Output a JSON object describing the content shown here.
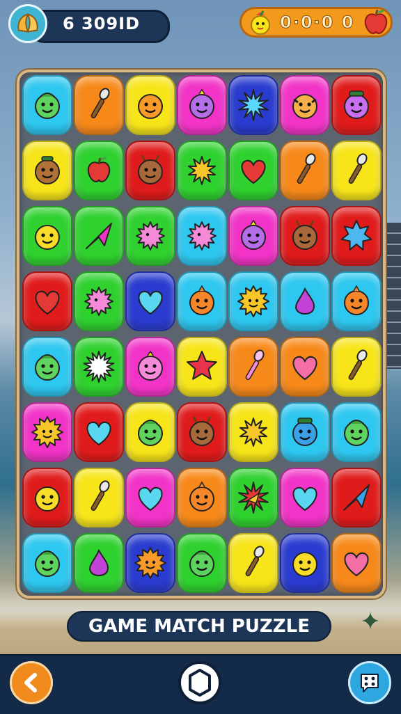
{
  "header": {
    "currency": {
      "icon": "golden-wings-icon",
      "amount": "6 309ID"
    },
    "lives": {
      "left_icon": "chick-fruit-icon",
      "value": "0·0·0 0",
      "right_icon": "apple-icon"
    }
  },
  "board": {
    "columns": 7,
    "rows": [
      [
        {
          "color": "#2ec7f0",
          "icon": "green-blob-face"
        },
        {
          "color": "#f7891a",
          "icon": "microphone"
        },
        {
          "color": "#f7e51a",
          "icon": "orange-smiley-face"
        },
        {
          "color": "#f233c7",
          "icon": "purple-bird-face"
        },
        {
          "color": "#2a3ccf",
          "icon": "blue-starburst"
        },
        {
          "color": "#f233c7",
          "icon": "orange-cow-face"
        },
        {
          "color": "#e01b1b",
          "icon": "purple-capped-face"
        }
      ],
      [
        {
          "color": "#f7e51a",
          "icon": "brown-monkey-face"
        },
        {
          "color": "#2fd12f",
          "icon": "red-apple"
        },
        {
          "color": "#e01b1b",
          "icon": "brown-deer-face"
        },
        {
          "color": "#2fd12f",
          "icon": "yellow-star"
        },
        {
          "color": "#2fd12f",
          "icon": "red-heart"
        },
        {
          "color": "#f7891a",
          "icon": "microphone"
        },
        {
          "color": "#f7e51a",
          "icon": "microphone"
        }
      ],
      [
        {
          "color": "#2fd12f",
          "icon": "yellow-smiley-face"
        },
        {
          "color": "#2fd12f",
          "icon": "pink-arrow"
        },
        {
          "color": "#2fd12f",
          "icon": "pink-spiky-ball"
        },
        {
          "color": "#2ec7f0",
          "icon": "pink-spiky-ball"
        },
        {
          "color": "#f233c7",
          "icon": "purple-bird-face"
        },
        {
          "color": "#e01b1b",
          "icon": "brown-deer-face"
        },
        {
          "color": "#e01b1b",
          "icon": "blue-splat"
        }
      ],
      [
        {
          "color": "#e01b1b",
          "icon": "red-heart"
        },
        {
          "color": "#2fd12f",
          "icon": "pink-spiky-ball"
        },
        {
          "color": "#2a3ccf",
          "icon": "cyan-heart"
        },
        {
          "color": "#2ec7f0",
          "icon": "orange-fish-face"
        },
        {
          "color": "#2ec7f0",
          "icon": "yellow-sun-face"
        },
        {
          "color": "#2ec7f0",
          "icon": "purple-drop"
        },
        {
          "color": "#2ec7f0",
          "icon": "orange-fish-face"
        }
      ],
      [
        {
          "color": "#2ec7f0",
          "icon": "green-blob-face"
        },
        {
          "color": "#2fd12f",
          "icon": "white-starburst"
        },
        {
          "color": "#f233c7",
          "icon": "pink-bird-face"
        },
        {
          "color": "#f7e51a",
          "icon": "red-star"
        },
        {
          "color": "#f7891a",
          "icon": "pink-microphone"
        },
        {
          "color": "#f7891a",
          "icon": "pink-heart"
        },
        {
          "color": "#f7e51a",
          "icon": "microphone"
        }
      ],
      [
        {
          "color": "#f233c7",
          "icon": "yellow-sun-face"
        },
        {
          "color": "#e01b1b",
          "icon": "cyan-heart"
        },
        {
          "color": "#f7e51a",
          "icon": "green-blob-face"
        },
        {
          "color": "#e01b1b",
          "icon": "brown-deer-face"
        },
        {
          "color": "#f7e51a",
          "icon": "yellow-star"
        },
        {
          "color": "#2ec7f0",
          "icon": "blue-capped-face"
        },
        {
          "color": "#2ec7f0",
          "icon": "green-blob-face"
        }
      ],
      [
        {
          "color": "#e01b1b",
          "icon": "yellow-smiley-face"
        },
        {
          "color": "#f7e51a",
          "icon": "microphone"
        },
        {
          "color": "#f233c7",
          "icon": "cyan-heart"
        },
        {
          "color": "#f7891a",
          "icon": "orange-fish-face"
        },
        {
          "color": "#2fd12f",
          "icon": "red-starburst"
        },
        {
          "color": "#f233c7",
          "icon": "cyan-heart"
        },
        {
          "color": "#e01b1b",
          "icon": "blue-arrow"
        }
      ],
      [
        {
          "color": "#2ec7f0",
          "icon": "green-blob-face"
        },
        {
          "color": "#2fd12f",
          "icon": "purple-drop"
        },
        {
          "color": "#2a3ccf",
          "icon": "orange-sun-face"
        },
        {
          "color": "#2fd12f",
          "icon": "green-blob-face"
        },
        {
          "color": "#f7e51a",
          "icon": "microphone"
        },
        {
          "color": "#2a3ccf",
          "icon": "yellow-smiley-face"
        },
        {
          "color": "#f7891a",
          "icon": "pink-heart"
        }
      ]
    ]
  },
  "title": "GAME MATCH PUZZLE",
  "nav": {
    "back_icon": "back-arrow-icon",
    "center_icon": "hexagon-gem-icon",
    "menu_icon": "dice-menu-icon"
  }
}
